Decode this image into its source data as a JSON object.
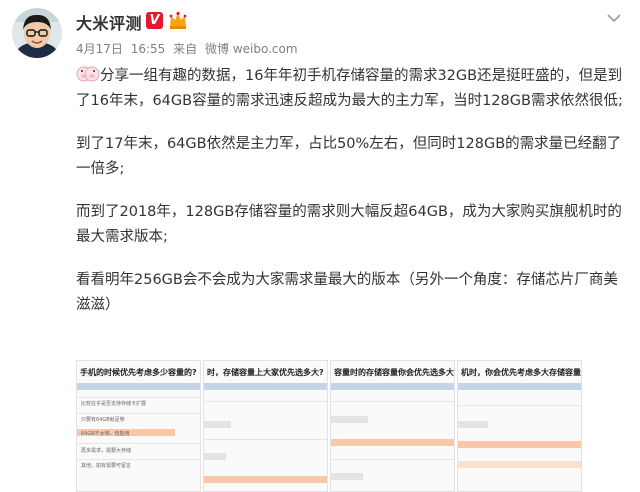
{
  "post": {
    "username": "大米评测",
    "verified_badge": "V",
    "date": "4月17日",
    "time": "16:55",
    "source_prefix": "来自",
    "source": "微博 weibo.com",
    "paragraphs": [
      {
        "text": "分享一组有趣的数据，16年年初手机存储容量的需求32GB还是挺旺盛的，但是到了16年末，64GB容量的需求迅速反超成为最大的主力军，当时128GB需求依然很低;",
        "emoji": "pig-emoji-icon"
      },
      {
        "text": "到了17年末，64GB依然是主力军，占比50%左右，但同时128GB的需求量已经翻了一倍多;"
      },
      {
        "text": "而到了2018年，128GB存储容量的需求则大幅反超64GB，成为大家购买旗舰机时的最大需求版本;"
      },
      {
        "text": "看看明年256GB会不会成为大家需求量最大的版本（另外一个角度：存储芯片厂商美滋滋）"
      }
    ]
  },
  "photos": [
    {
      "title": "手机的时候优先考虑多少容量的?",
      "rows": [
        "A. 16GB",
        "B. 32GB",
        "C. 64GB",
        "比较在乎是否支持存储卡扩展",
        "只要有64GB就足够",
        "64GB不太够，但能用",
        "再多需求，需要大存储",
        "不是非常在乎存储容量",
        "其他，如有需要可留言"
      ]
    },
    {
      "title": "时，存储容量上大家优先选多大?",
      "rows": [
        "A",
        "B",
        "C"
      ]
    },
    {
      "title": "容量时的存储容量你会优先选多大?",
      "rows": [
        "A",
        "B",
        "C"
      ]
    },
    {
      "title": "机时，你会优先考虑多大存储容量的?",
      "rows": [
        "A",
        "B",
        "C"
      ]
    }
  ],
  "colors": {
    "username": "#333333",
    "meta": "#808080",
    "verified": "#e6162d",
    "bar_blue": "#c5d4e6",
    "bar_orange": "#f9c8a8",
    "bar_gray": "#e4e4e4"
  }
}
